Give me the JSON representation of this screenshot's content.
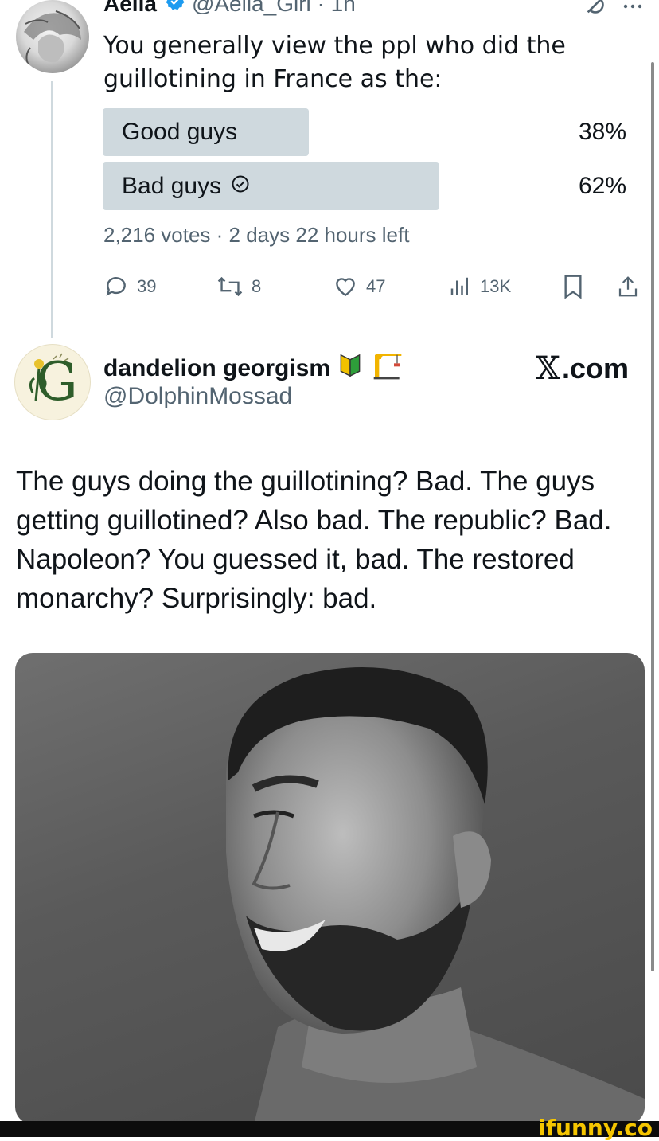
{
  "tweet1": {
    "name": "Aella",
    "handle_time": "@Aella_Girl · 1h",
    "text": "You generally view the ppl who did the guillotining in France as the:",
    "poll": {
      "options": [
        {
          "label": "Good guys",
          "percent_text": "38%",
          "share": 0.38,
          "selected": false
        },
        {
          "label": "Bad guys",
          "percent_text": "62%",
          "share": 0.62,
          "selected": true
        }
      ],
      "summary": "2,216 votes · 2 days 22 hours left"
    },
    "actions": {
      "replies": "39",
      "reposts": "8",
      "likes": "47",
      "views": "13K"
    },
    "icons": [
      "verified-badge-icon",
      "grok-icon",
      "more-icon",
      "reply-icon",
      "repost-icon",
      "like-icon",
      "views-icon",
      "bookmark-icon",
      "share-icon"
    ]
  },
  "tweet2": {
    "name": "dandelion georgism",
    "emoji_badges": [
      "🔰",
      "🏗"
    ],
    "handle": "@DolphinMossad",
    "source": ".com",
    "text": "The guys doing the guillotining? Bad. The guys getting guillotined? Also bad. The republic? Bad. Napoleon? You guessed it, bad. The restored monarchy? Surprisingly: bad.",
    "avatar_letter": "G"
  },
  "watermark": "ifunny.co",
  "colors": {
    "text": "#0f1419",
    "muted": "#536471",
    "poll_fill": "#cfd9de",
    "verified": "#1d9bf0",
    "watermark": "#f5c500"
  }
}
